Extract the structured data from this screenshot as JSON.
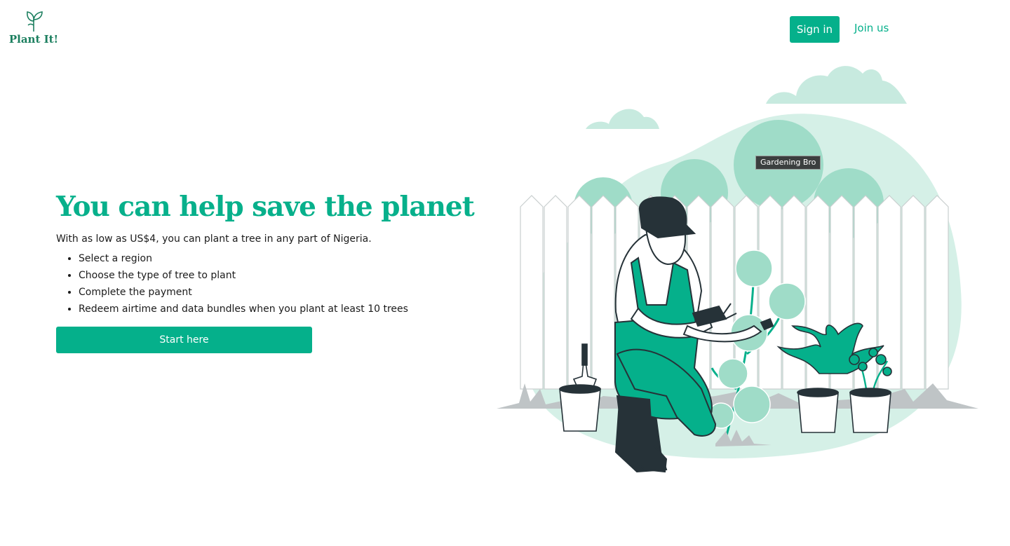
{
  "brand": {
    "name": "Plant It!",
    "color": "#05b08b",
    "logo_icon": "sprout-icon"
  },
  "nav": {
    "signin_label": "Sign in",
    "join_label": "Join us"
  },
  "hero": {
    "title": "You can help save the planet",
    "intro": "With as low as US$4, you can plant a tree in any part of Nigeria.",
    "steps": [
      "Select a region",
      "Choose the type of tree to plant",
      "Complete the payment",
      "Redeem airtime and data bundles when you plant at least 10 trees"
    ],
    "cta_label": "Start here"
  },
  "illustration": {
    "tooltip": "Gardening Bro",
    "subject": "gardener-trimming-plants-illustration"
  }
}
